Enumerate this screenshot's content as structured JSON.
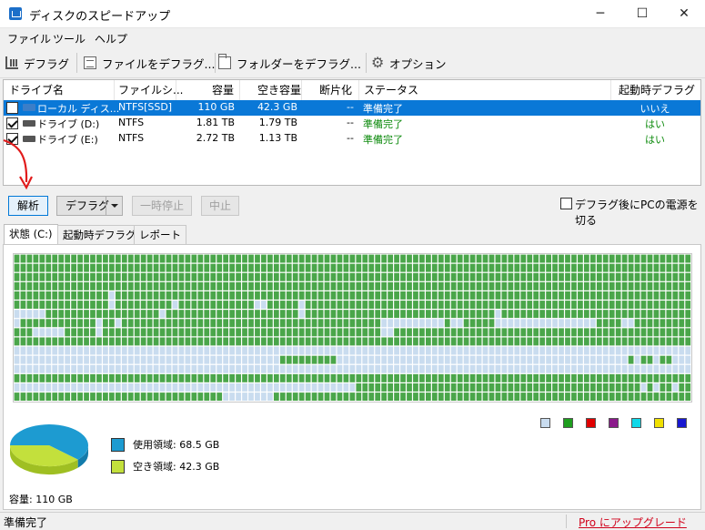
{
  "window": {
    "title": "ディスクのスピードアップ",
    "min": "─",
    "max": "☐",
    "close": "✕"
  },
  "menu": [
    "ファイル",
    "ツール",
    "ヘルプ"
  ],
  "toolbar": {
    "defrag": "デフラグ",
    "defrag_files": "ファイルをデフラグ...",
    "defrag_folder": "フォルダーをデフラグ...",
    "options": "オプション"
  },
  "drive_table": {
    "headers": {
      "name": "ドライブ名",
      "fs": "ファイルシ...",
      "capacity": "容量",
      "free": "空き容量",
      "frag": "断片化",
      "status": "ステータス",
      "boot": "起動時デフラグ"
    },
    "rows": [
      {
        "checked": false,
        "icon": "windows-drive-icon",
        "name": "ローカル ディス...",
        "fs": "NTFS[SSD]",
        "capacity": "110 GB",
        "free": "42.3 GB",
        "frag": "--",
        "status": "準備完了",
        "boot": "いいえ",
        "selected": true
      },
      {
        "checked": true,
        "icon": "hard-drive-icon",
        "name": "ドライブ (D:)",
        "fs": "NTFS",
        "capacity": "1.81 TB",
        "free": "1.79 TB",
        "frag": "--",
        "status": "準備完了",
        "boot": "はい",
        "selected": false
      },
      {
        "checked": true,
        "icon": "hard-drive-icon",
        "name": "ドライブ (E:)",
        "fs": "NTFS",
        "capacity": "2.72 TB",
        "free": "1.13 TB",
        "frag": "--",
        "status": "準備完了",
        "boot": "はい",
        "selected": false
      }
    ]
  },
  "actions": {
    "analyze": "解析",
    "defrag": "デフラグ",
    "pause": "一時停止",
    "stop": "中止",
    "power_off": "デフラグ後にPCの電源を切る"
  },
  "tabs": [
    "状態 (C:)",
    "起動時デフラグ",
    "レポート"
  ],
  "cluster_map": {
    "used_color": "#4aa64a",
    "free_color": "#c9dcef",
    "rows": [
      "11111111111111111111111111111111111111111111111111111111111111111111111111111111111111111111111111111111111",
      "11111111111111111111111111111111111111111111111111111111111111111111111111111111111111111111111111111111111",
      "11111111111111111111111111111111111111111111111111111111111111111111111111111111111111111111111111111111111",
      "11111111111111111111111111111111111111111111111111111111111111111111111111111111111111111111111111111111111",
      "11111111111111101111111111111111111111111111111111111111111111111111111111111111111111111111111111111111111",
      "11111111111111101111111110111111111111001111101111111111111111111111111111111111111111111111111111111111111",
      "00000111111111111111111011111111111111111111101111111111111111111111111111110111111111111111111111111111111",
      "01111111111110110111111111111111111111111111111111111111110000000000100111110000000000000000111100111111111",
      "11100000111110111111111111111111111111111111111111111111110011111111111111111111111111111111111111111111111",
      "11111111111111111111111111111111111111111111111111111111111111111111111111111111111111111111111111111111111",
      "00000000000000000000000000000000000000000000000000000000000000000000000000000000000000000000000000000000000",
      "00000000000000000000000000000000000000000011111111100000000000000000000000000000000000000000000001011011000",
      "00000000000000000000000000000000000000000000000000000000000000000000000000000000000000000000000000000000000",
      "11111111111111111111111111111111111111111111111111111111111111111111111111111111111111111111111111111111111",
      "00000000000000000000000000000000000000000000000000000011111111111111111111111111111111111111111111101011011",
      "11111111111111111111111111111111100000000111111111111111111111111111111111111111111111111111111111111111111"
    ]
  },
  "legend_swatches": [
    "#c9dcef",
    "#1e9e1e",
    "#e00000",
    "#8b1a8b",
    "#10d8e8",
    "#f0e000",
    "#1818d0"
  ],
  "usage": {
    "used": {
      "label": "使用領域: 68.5 GB",
      "value_gb": 68.5,
      "color": "#1d9bd1"
    },
    "free": {
      "label": "空き領域: 42.3 GB",
      "value_gb": 42.3,
      "color": "#c3e03c"
    },
    "capacity": "容量: 110 GB"
  },
  "status_bar": {
    "text": "準備完了",
    "upgrade_link": "Pro にアップグレード"
  }
}
